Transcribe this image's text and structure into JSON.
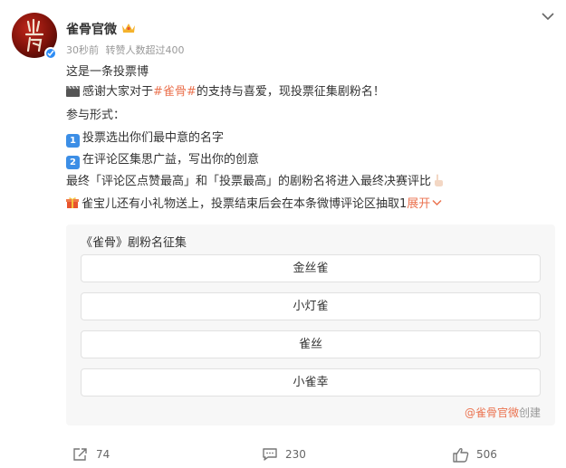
{
  "post": {
    "author": "雀骨官微",
    "time": "30秒前",
    "repost_stat": "转赞人数超过400",
    "avatar_text": "雀骨",
    "lines": {
      "l1": "这是一条投票博",
      "l2_pre": "感谢大家对于",
      "l2_tag": "#雀骨#",
      "l2_post": "的支持与喜爱，现投票征集剧粉名！",
      "l3": "参与形式：",
      "l4_num": "1",
      "l4": "投票选出你们最中意的名字",
      "l5_num": "2",
      "l5": "在评论区集思广益，写出你的创意",
      "l6": "最终「评论区点赞最高」和「投票最高」的剧粉名将进入最终决赛评比",
      "l7": "雀宝儿还有小礼物送上，投票结束后会在本条微博评论区抽取1",
      "expand": "展开"
    }
  },
  "vote": {
    "title": "《雀骨》剧粉名征集",
    "options": [
      "金丝雀",
      "小灯雀",
      "雀丝",
      "小雀幸"
    ],
    "creator_at": "@雀骨官微",
    "creator_suffix": "创建"
  },
  "actions": {
    "repost_count": "74",
    "comment_count": "230",
    "like_count": "506"
  },
  "colors": {
    "link": "#eb7350",
    "verify": "#2f8df5",
    "number_box": "#3c8ee6"
  },
  "icons": {
    "repost": "repost-icon",
    "comment": "comment-icon",
    "like": "thumbs-up-icon",
    "more": "chevron-down-icon"
  }
}
